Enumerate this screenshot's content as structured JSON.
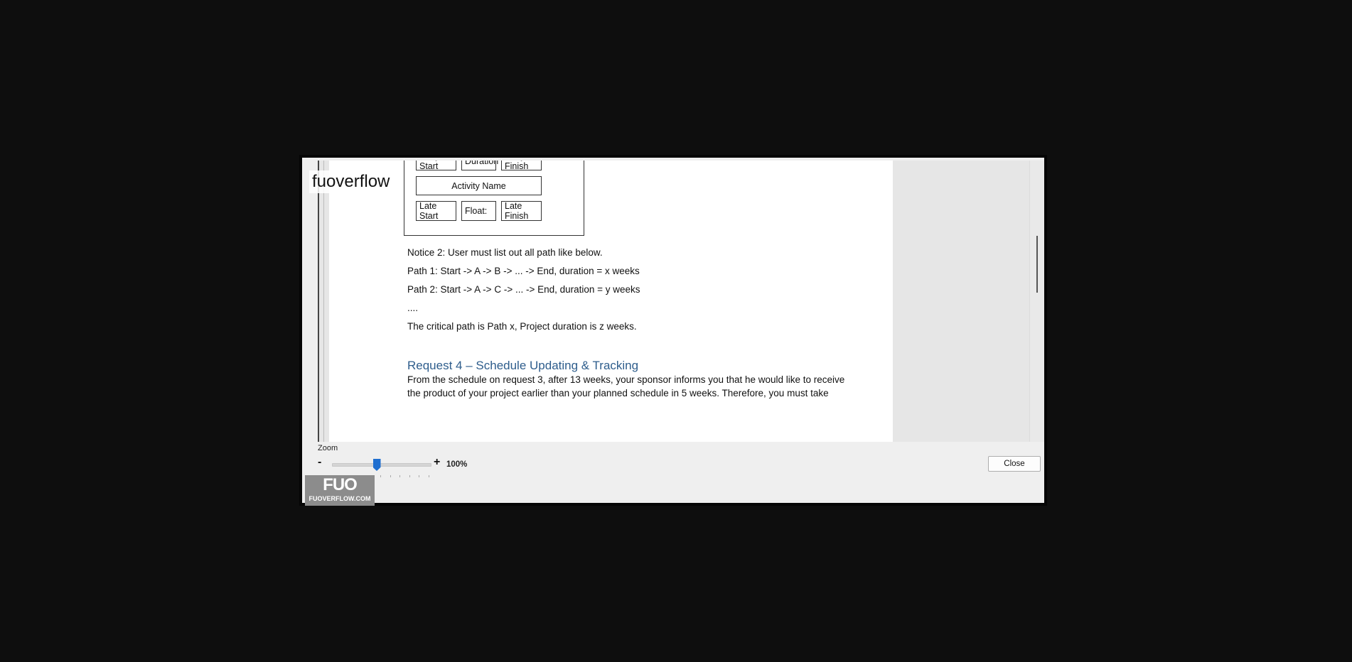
{
  "watermark": {
    "text": "fuoverflow"
  },
  "diagram": {
    "early_start": "Early Start",
    "duration": "Duration",
    "early_finish": "Early Finish",
    "activity_name": "Activity Name",
    "late_start": "Late Start",
    "float": "Float:",
    "late_finish": "Late Finish"
  },
  "document": {
    "notice2": "Notice 2: User must list out all path like below.",
    "path1": "Path 1: Start -> A -> B -> ... -> End, duration = x weeks",
    "path2": "Path 2: Start -> A -> C -> ... -> End, duration = y weeks",
    "ellipsis": "....",
    "critical": "The critical path is Path x, Project duration is z weeks.",
    "request4_heading": "Request 4 – Schedule Updating & Tracking",
    "request4_line1": "From the schedule on request 3, after 13 weeks, your sponsor informs you that he would like to receive",
    "request4_line2": "the product of your project earlier than your planned schedule in 5 weeks. Therefore, you must take"
  },
  "zoom": {
    "label": "Zoom",
    "minus": "-",
    "plus": "+",
    "value": "100%",
    "level_fraction": 0.45
  },
  "buttons": {
    "close": "Close"
  },
  "logo": {
    "big": "FUO",
    "small": "FUOVERFLOW.COM"
  },
  "colors": {
    "heading": "#2e5d8c",
    "slider_thumb": "#1f6fd0"
  }
}
